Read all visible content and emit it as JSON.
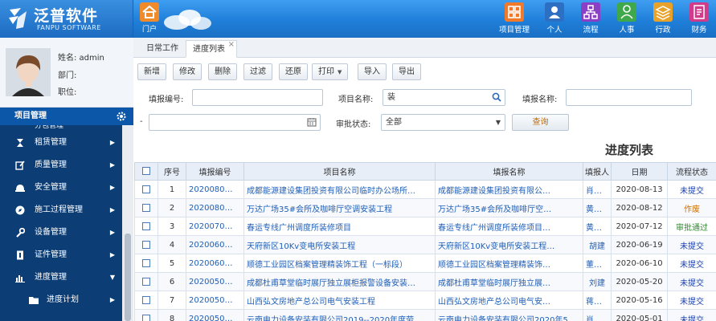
{
  "brand": {
    "name_cn": "泛普软件",
    "name_en": "FANPU SOFTWARE"
  },
  "header": {
    "portal_label": "门户",
    "nav": [
      {
        "label": "项目管理",
        "icon": "grid-icon",
        "color": "#f07a2a"
      },
      {
        "label": "个人",
        "icon": "person-icon",
        "color": "#2d6fc2"
      },
      {
        "label": "流程",
        "icon": "flow-icon",
        "color": "#8a3fc4"
      },
      {
        "label": "人事",
        "icon": "people-icon",
        "color": "#3fa84a"
      },
      {
        "label": "行政",
        "icon": "layers-icon",
        "color": "#e8a22a"
      },
      {
        "label": "财务",
        "icon": "finance-icon",
        "color": "#d23a8a"
      }
    ]
  },
  "user": {
    "name": "姓名: admin",
    "dept": "部门:",
    "position": "职位:"
  },
  "menu": {
    "header": "项目管理",
    "partial_item": "分包管理",
    "items": [
      {
        "label": "租赁管理",
        "icon": "hourglass-icon"
      },
      {
        "label": "质量管理",
        "icon": "edit-icon"
      },
      {
        "label": "安全管理",
        "icon": "helmet-icon"
      },
      {
        "label": "施工过程管理",
        "icon": "compass-icon"
      },
      {
        "label": "设备管理",
        "icon": "wrench-icon"
      },
      {
        "label": "证件管理",
        "icon": "certificate-icon"
      },
      {
        "label": "进度管理",
        "icon": "bar-chart-icon",
        "expanded": true
      }
    ],
    "sub_items": [
      {
        "label": "进度计划",
        "icon": "folder-icon"
      }
    ]
  },
  "tabs": [
    {
      "label": "日常工作",
      "active": false
    },
    {
      "label": "进度列表",
      "active": true
    }
  ],
  "toolbar": {
    "add": "新增",
    "edit": "修改",
    "delete": "删除",
    "filter": "过滤",
    "restore": "还原",
    "print": "打印",
    "import": "导入",
    "export": "导出"
  },
  "filters": {
    "report_no_label": "填报编号:",
    "report_no_value": "",
    "project_name_label": "项目名称:",
    "project_name_value": "装",
    "report_name_label": "填报名称:",
    "report_name_value": "",
    "date_sep": "-",
    "date_value": "",
    "approval_label": "审批状态:",
    "approval_value": "全部",
    "query": "查询"
  },
  "grid": {
    "title": "进度列表",
    "columns": [
      "序号",
      "填报编号",
      "项目名称",
      "填报名称",
      "填报人",
      "日期",
      "流程状态"
    ],
    "rows": [
      {
        "num": "1",
        "code": "2020080…",
        "project": "成都能源建设集团投资有限公司临时办公场所…",
        "report": "成都能源建设集团投资有限公…",
        "user": "肖亚军",
        "date": "2020-08-13",
        "status": "未提交",
        "status_type": "unsub"
      },
      {
        "num": "2",
        "code": "2020080…",
        "project": "万达广场35#会所及咖啡厅空调安装工程",
        "report": "万达广场35#会所及咖啡厅空…",
        "user": "黄一飞",
        "date": "2020-08-12",
        "status": "作废",
        "status_type": "void"
      },
      {
        "num": "3",
        "code": "2020070…",
        "project": "春运专线广州调度所装修项目",
        "report": "春运专线广州调度所装修项目…",
        "user": "黄思聪",
        "date": "2020-07-12",
        "status": "审批通过",
        "status_type": "ok"
      },
      {
        "num": "4",
        "code": "2020060…",
        "project": "天府新区10Kv变电所安装工程",
        "report": "天府新区10Kv变电所安装工程…",
        "user": "胡建",
        "date": "2020-06-19",
        "status": "未提交",
        "status_type": "unsub"
      },
      {
        "num": "5",
        "code": "2020060…",
        "project": "顺德工业园区档案管理精装饰工程（一标段）",
        "report": "顺德工业园区档案管理精装饰…",
        "user": "董清平",
        "date": "2020-06-10",
        "status": "未提交",
        "status_type": "unsub"
      },
      {
        "num": "6",
        "code": "2020050…",
        "project": "成都杜甫草堂临时展厅独立展柜报警设备安装…",
        "report": "成都杜甫草堂临时展厅独立展…",
        "user": "刘建",
        "date": "2020-05-20",
        "status": "未提交",
        "status_type": "unsub"
      },
      {
        "num": "7",
        "code": "2020050…",
        "project": "山西弘文房地产总公司电气安装工程",
        "report": "山西弘文房地产总公司电气安…",
        "user": "蒋德帧",
        "date": "2020-05-16",
        "status": "未提交",
        "status_type": "unsub"
      },
      {
        "num": "8",
        "code": "2020050…",
        "project": "云南电力设备安装有限公司2019--2020年度劳…",
        "report": "云南电力设备安装有限公司2020年5月…",
        "user": "肖亚军",
        "date": "2020-05-01",
        "status": "未提交",
        "status_type": "unsub"
      }
    ]
  }
}
